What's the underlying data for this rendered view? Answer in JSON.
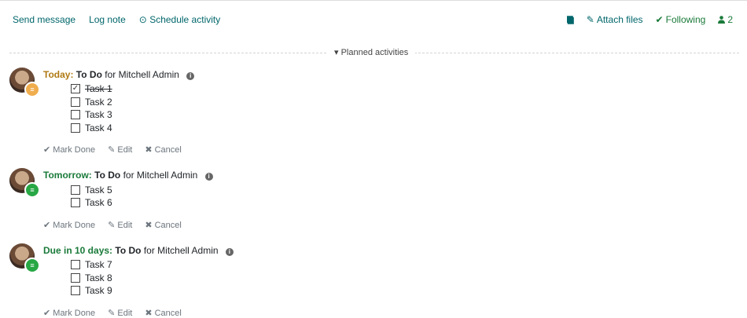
{
  "toolbar": {
    "send_message": "Send message",
    "log_note": "Log note",
    "schedule_activity": "Schedule activity"
  },
  "right_tools": {
    "attach_files": "Attach files",
    "following": "Following",
    "followers_count": "2"
  },
  "divider": {
    "label": "Planned activities"
  },
  "activities": [
    {
      "due": "Today:",
      "type": "To Do",
      "for": "for Mitchell Admin",
      "tasks": [
        "Task 1",
        "Task 2",
        "Task 3",
        "Task 4"
      ],
      "done_tasks": [
        0
      ]
    },
    {
      "due": "Tomorrow:",
      "type": "To Do",
      "for": "for Mitchell Admin",
      "tasks": [
        "Task 5",
        "Task 6"
      ],
      "done_tasks": []
    },
    {
      "due": "Due in 10 days:",
      "type": "To Do",
      "for": "for Mitchell Admin",
      "tasks": [
        "Task 7",
        "Task 8",
        "Task 9"
      ],
      "done_tasks": []
    }
  ],
  "action_labels": {
    "mark_done": "Mark Done",
    "edit": "Edit",
    "cancel": "Cancel"
  },
  "colors": {
    "link": "#01666b",
    "today": "#b07a14",
    "future": "#1a7a3a",
    "badge_today": "#f0ad4e",
    "badge_future": "#28a745"
  },
  "icons": {
    "schedule": "clock-icon",
    "book": "book-icon",
    "attach": "paperclip-icon",
    "following": "check-icon",
    "followers": "user-icon",
    "divider": "caret-down-icon",
    "info": "info-icon",
    "mark_done": "check-icon",
    "edit": "pencil-icon",
    "cancel": "times-icon"
  }
}
